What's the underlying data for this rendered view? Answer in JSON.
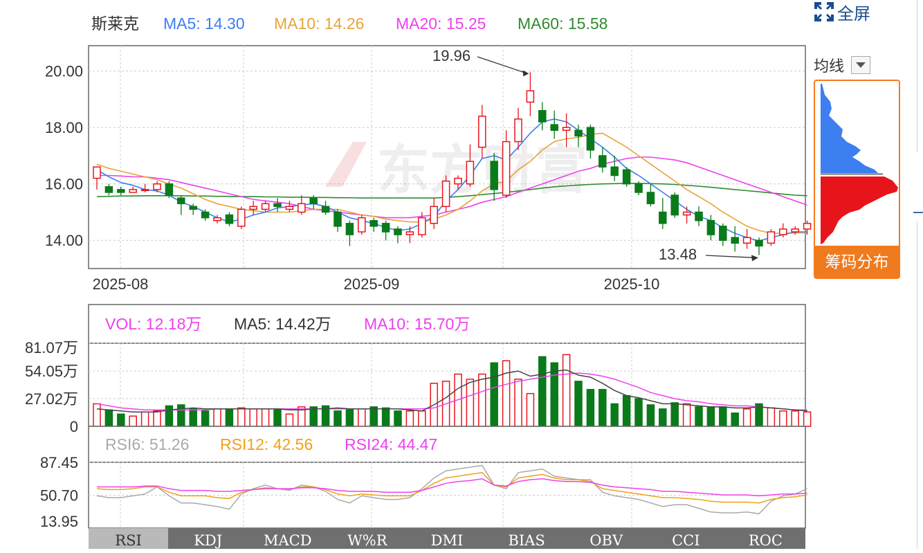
{
  "header": {
    "stock_name": "斯莱克",
    "ma5": "MA5: 14.30",
    "ma10": "MA10: 14.26",
    "ma20": "MA20: 15.25",
    "ma60": "MA60: 15.58"
  },
  "vol_header": {
    "vol": "VOL: 12.18万",
    "ma5": "MA5: 14.42万",
    "ma10": "MA10: 15.70万"
  },
  "rsi_header": {
    "rsi6": "RSI6: 51.26",
    "rsi12": "RSI12: 42.56",
    "rsi24": "RSI24: 44.47"
  },
  "fullscreen_label": "全屏",
  "ma_select_label": "均线",
  "chip_button": "筹码分布",
  "tabs": [
    "RSI",
    "KDJ",
    "MACD",
    "W%R",
    "DMI",
    "BIAS",
    "OBV",
    "CCI",
    "ROC"
  ],
  "colors": {
    "up": "#e8141c",
    "down": "#0a7a1a",
    "ma5": "#3d7ef0",
    "ma10": "#e8a33a",
    "ma20": "#ee40ee",
    "ma60": "#2e8b2e",
    "rsi6": "#a9a9a9",
    "rsi12": "#f0a018",
    "rsi24": "#ee40ee",
    "volma5": "#444444",
    "volma10": "#ee40ee"
  },
  "chart_data": [
    {
      "type": "candlestick",
      "ylim": [
        13.0,
        20.9
      ],
      "yticks": [
        "20.00",
        "18.00",
        "16.00",
        "14.00"
      ],
      "ytick_values": [
        20,
        18,
        16,
        14
      ],
      "xticks": [
        {
          "label": "2025-08",
          "index": 1
        },
        {
          "label": "2025-09",
          "index": 23
        },
        {
          "label": "2025-10",
          "index": 45
        }
      ],
      "annotations": [
        {
          "label": "19.96",
          "index": 36,
          "value": 19.96
        },
        {
          "label": "13.48",
          "index": 55,
          "value": 13.48
        }
      ],
      "candles": [
        [
          16.2,
          16.6,
          16.62,
          15.8
        ],
        [
          15.9,
          15.7,
          16.0,
          15.6
        ],
        [
          15.8,
          15.7,
          15.9,
          15.6
        ],
        [
          15.7,
          15.8,
          15.9,
          15.7
        ],
        [
          15.8,
          15.8,
          16.0,
          15.7
        ],
        [
          15.8,
          16.0,
          16.1,
          15.7
        ],
        [
          16.0,
          15.6,
          16.1,
          15.5
        ],
        [
          15.5,
          15.3,
          15.6,
          14.9
        ],
        [
          15.2,
          15.1,
          15.3,
          14.9
        ],
        [
          15.0,
          14.8,
          15.1,
          14.7
        ],
        [
          14.7,
          14.8,
          14.9,
          14.6
        ],
        [
          14.9,
          14.6,
          15.0,
          14.5
        ],
        [
          14.5,
          15.1,
          15.2,
          14.4
        ],
        [
          15.1,
          15.2,
          15.4,
          14.9
        ],
        [
          15.1,
          15.3,
          15.4,
          15.0
        ],
        [
          15.3,
          15.2,
          15.5,
          15.0
        ],
        [
          15.1,
          15.2,
          15.4,
          15.0
        ],
        [
          15.0,
          15.3,
          15.6,
          14.9
        ],
        [
          15.5,
          15.3,
          15.6,
          15.1
        ],
        [
          15.2,
          15.0,
          15.4,
          14.9
        ],
        [
          15.0,
          14.5,
          15.1,
          14.3
        ],
        [
          14.6,
          14.2,
          14.7,
          13.8
        ],
        [
          14.3,
          14.8,
          14.9,
          14.2
        ],
        [
          14.7,
          14.5,
          14.8,
          14.3
        ],
        [
          14.6,
          14.3,
          14.7,
          14.0
        ],
        [
          14.4,
          14.2,
          14.5,
          13.9
        ],
        [
          14.2,
          14.3,
          14.5,
          13.9
        ],
        [
          14.2,
          14.8,
          15.0,
          14.1
        ],
        [
          14.6,
          15.2,
          15.5,
          14.4
        ],
        [
          15.2,
          16.1,
          16.3,
          15.0
        ],
        [
          16.0,
          16.2,
          16.3,
          15.8
        ],
        [
          16.0,
          16.8,
          17.4,
          15.9
        ],
        [
          17.3,
          18.4,
          18.8,
          16.9
        ],
        [
          16.8,
          15.8,
          17.1,
          15.4
        ],
        [
          15.6,
          17.5,
          17.9,
          15.5
        ],
        [
          17.5,
          18.3,
          18.7,
          17.2
        ],
        [
          18.9,
          19.3,
          19.96,
          18.4
        ],
        [
          18.6,
          18.2,
          18.9,
          17.9
        ],
        [
          18.1,
          17.9,
          18.6,
          17.6
        ],
        [
          17.9,
          18.0,
          18.5,
          17.3
        ],
        [
          17.9,
          17.7,
          18.1,
          17.3
        ],
        [
          18.0,
          17.2,
          18.1,
          16.9
        ],
        [
          17.0,
          16.6,
          17.3,
          16.4
        ],
        [
          16.6,
          16.3,
          17.0,
          16.1
        ],
        [
          16.5,
          16.0,
          16.6,
          15.9
        ],
        [
          16.0,
          15.7,
          16.1,
          15.6
        ],
        [
          15.7,
          15.3,
          16.0,
          15.2
        ],
        [
          15.0,
          14.6,
          15.5,
          14.4
        ],
        [
          15.6,
          14.9,
          15.7,
          14.8
        ],
        [
          14.9,
          15.0,
          15.2,
          14.6
        ],
        [
          15.0,
          14.7,
          15.2,
          14.5
        ],
        [
          14.7,
          14.2,
          14.9,
          14.0
        ],
        [
          14.5,
          14.0,
          14.6,
          13.8
        ],
        [
          14.1,
          13.9,
          14.5,
          13.6
        ],
        [
          13.9,
          14.1,
          14.4,
          13.7
        ],
        [
          14.0,
          13.8,
          14.1,
          13.48
        ],
        [
          13.9,
          14.3,
          14.4,
          13.8
        ],
        [
          14.2,
          14.4,
          14.6,
          14.1
        ],
        [
          14.3,
          14.4,
          14.5,
          14.2
        ],
        [
          14.4,
          14.6,
          14.7,
          14.2
        ]
      ],
      "ma5": [
        16.5,
        16.25,
        16.05,
        15.95,
        15.8,
        15.75,
        15.6,
        15.35,
        15.2,
        15.0,
        14.8,
        14.65,
        14.75,
        14.9,
        15.0,
        15.15,
        15.2,
        15.25,
        15.3,
        15.2,
        15.0,
        14.8,
        14.7,
        14.6,
        14.45,
        14.35,
        14.4,
        14.6,
        14.85,
        15.4,
        15.8,
        16.3,
        16.9,
        17.0,
        16.85,
        17.3,
        17.8,
        18.2,
        18.3,
        18.2,
        17.9,
        17.6,
        17.3,
        16.95,
        16.55,
        16.3,
        16.0,
        15.7,
        15.4,
        15.1,
        14.85,
        14.7,
        14.45,
        14.25,
        14.1,
        13.98,
        14.1,
        14.2,
        14.3,
        14.3
      ],
      "ma10": [
        16.7,
        16.55,
        16.45,
        16.35,
        16.25,
        16.15,
        16.0,
        15.85,
        15.65,
        15.45,
        15.3,
        15.2,
        15.1,
        15.05,
        15.0,
        15.0,
        15.0,
        15.05,
        15.1,
        15.1,
        15.1,
        15.0,
        14.9,
        14.85,
        14.75,
        14.7,
        14.65,
        14.65,
        14.75,
        14.9,
        15.1,
        15.4,
        15.75,
        16.0,
        16.1,
        16.5,
        16.8,
        17.2,
        17.5,
        17.6,
        17.65,
        17.75,
        17.8,
        17.55,
        17.3,
        17.0,
        16.7,
        16.4,
        16.1,
        15.8,
        15.55,
        15.3,
        15.0,
        14.75,
        14.5,
        14.35,
        14.25,
        14.25,
        14.26,
        14.26
      ],
      "ma20": [
        16.3,
        16.3,
        16.28,
        16.25,
        16.25,
        16.2,
        16.15,
        16.05,
        15.95,
        15.85,
        15.75,
        15.65,
        15.55,
        15.45,
        15.4,
        15.35,
        15.3,
        15.2,
        15.1,
        15.05,
        15.0,
        14.95,
        14.9,
        14.85,
        14.8,
        14.8,
        14.8,
        14.85,
        14.9,
        15.0,
        15.1,
        15.2,
        15.35,
        15.45,
        15.55,
        15.7,
        15.85,
        16.0,
        16.15,
        16.3,
        16.45,
        16.55,
        16.7,
        16.8,
        16.9,
        16.95,
        16.95,
        16.9,
        16.85,
        16.75,
        16.6,
        16.45,
        16.3,
        16.15,
        16.0,
        15.85,
        15.7,
        15.55,
        15.4,
        15.25
      ],
      "ma60": [
        15.55,
        15.56,
        15.57,
        15.57,
        15.58,
        15.58,
        15.58,
        15.58,
        15.57,
        15.57,
        15.56,
        15.56,
        15.55,
        15.55,
        15.54,
        15.54,
        15.53,
        15.53,
        15.52,
        15.52,
        15.51,
        15.51,
        15.5,
        15.5,
        15.5,
        15.5,
        15.5,
        15.5,
        15.5,
        15.52,
        15.55,
        15.58,
        15.62,
        15.66,
        15.7,
        15.75,
        15.8,
        15.85,
        15.9,
        15.93,
        15.96,
        15.98,
        16.0,
        16.01,
        16.02,
        16.02,
        16.01,
        16.0,
        15.98,
        15.95,
        15.92,
        15.88,
        15.84,
        15.8,
        15.76,
        15.72,
        15.68,
        15.64,
        15.6,
        15.58
      ]
    },
    {
      "type": "bar",
      "ylim": [
        0,
        81.07
      ],
      "yticks": [
        "81.07万",
        "54.05万",
        "27.02万",
        "0"
      ],
      "ytick_values": [
        81.07,
        54.05,
        27.02,
        0
      ],
      "vol": [
        22,
        16,
        12,
        10,
        14,
        15,
        20,
        21,
        17,
        15,
        17,
        17,
        18,
        17,
        17,
        16,
        12,
        19,
        19,
        20,
        15,
        16,
        17,
        19,
        18,
        15,
        15,
        15,
        42,
        44,
        51,
        46,
        51,
        62,
        64,
        46,
        32,
        68,
        62,
        70,
        44,
        36,
        36,
        22,
        30,
        27,
        21,
        17,
        23,
        22,
        19,
        19,
        19,
        13,
        17,
        22,
        18,
        15,
        15,
        14
      ],
      "vol_ma5": [
        17,
        16,
        15,
        14,
        14,
        14,
        16,
        17,
        18,
        17,
        17,
        17,
        17,
        17,
        17,
        17,
        16,
        16,
        17,
        17,
        18,
        17,
        17,
        17,
        17,
        17,
        16,
        15,
        21,
        28,
        37,
        43,
        46,
        48,
        52,
        54,
        49,
        51,
        54,
        55,
        50,
        48,
        42,
        35,
        30,
        28,
        25,
        22,
        22,
        21,
        20,
        19,
        19,
        18,
        18,
        19,
        18,
        17,
        16,
        15
      ],
      "vol_ma10": [
        22,
        20,
        18,
        17,
        16,
        16,
        16,
        16,
        16,
        16,
        17,
        17,
        17,
        17,
        17,
        17,
        17,
        17,
        17,
        17,
        17,
        17,
        17,
        17,
        17,
        17,
        17,
        17,
        18,
        22,
        26,
        30,
        34,
        38,
        41,
        44,
        46,
        48,
        50,
        51,
        52,
        51,
        49,
        46,
        42,
        38,
        33,
        30,
        27,
        25,
        24,
        22,
        21,
        20,
        20,
        19,
        18,
        17,
        16,
        16
      ]
    },
    {
      "type": "line",
      "ylim": [
        13.95,
        87.45
      ],
      "yticks": [
        "87.45",
        "50.70",
        "13.95"
      ],
      "ytick_values": [
        87.45,
        50.7,
        13.95
      ],
      "rsi6": [
        50,
        48,
        48,
        50,
        52,
        60,
        50,
        42,
        42,
        40,
        38,
        35,
        52,
        58,
        62,
        58,
        56,
        62,
        60,
        55,
        46,
        42,
        50,
        48,
        46,
        46,
        48,
        58,
        70,
        78,
        80,
        82,
        84,
        62,
        58,
        76,
        78,
        80,
        72,
        70,
        68,
        68,
        54,
        50,
        48,
        46,
        42,
        38,
        40,
        40,
        36,
        32,
        31,
        31,
        32,
        30,
        44,
        50,
        52,
        58
      ],
      "rsi12": [
        58,
        57,
        57,
        58,
        60,
        60,
        54,
        50,
        50,
        50,
        48,
        47,
        54,
        57,
        59,
        58,
        57,
        60,
        60,
        57,
        52,
        50,
        52,
        51,
        50,
        50,
        50,
        56,
        64,
        70,
        72,
        74,
        76,
        62,
        60,
        70,
        72,
        74,
        70,
        68,
        68,
        66,
        58,
        56,
        54,
        52,
        50,
        48,
        48,
        47,
        46,
        44,
        43,
        43,
        43,
        42,
        46,
        48,
        49,
        51
      ],
      "rsi24": [
        60,
        60,
        60,
        60,
        61,
        61,
        58,
        56,
        56,
        56,
        55,
        55,
        56,
        57,
        58,
        58,
        58,
        59,
        59,
        58,
        56,
        55,
        55,
        55,
        54,
        54,
        54,
        56,
        60,
        64,
        66,
        67,
        69,
        62,
        61,
        66,
        68,
        69,
        67,
        66,
        66,
        65,
        62,
        60,
        59,
        58,
        57,
        55,
        55,
        54,
        53,
        52,
        51,
        51,
        51,
        50,
        51,
        52,
        52,
        53
      ]
    }
  ]
}
